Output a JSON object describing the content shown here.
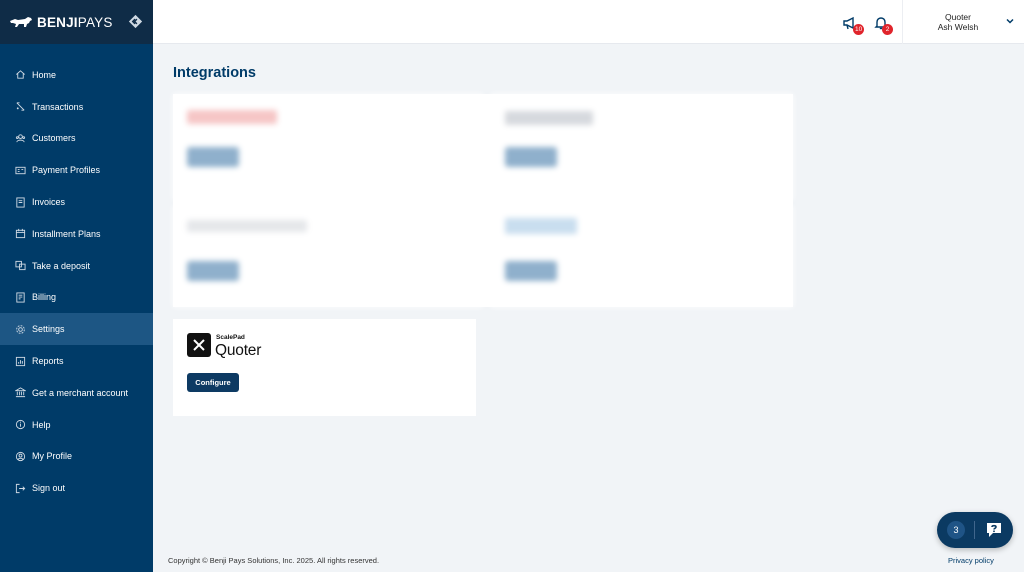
{
  "brand": {
    "name_bold": "BENJI",
    "name_rest": "PAYS"
  },
  "sidebar": {
    "items": [
      {
        "label": "Home",
        "icon": "home-icon"
      },
      {
        "label": "Transactions",
        "icon": "transactions-icon"
      },
      {
        "label": "Customers",
        "icon": "customers-icon"
      },
      {
        "label": "Payment Profiles",
        "icon": "payment-profiles-icon"
      },
      {
        "label": "Invoices",
        "icon": "invoices-icon"
      },
      {
        "label": "Installment Plans",
        "icon": "calendar-icon"
      },
      {
        "label": "Take a deposit",
        "icon": "deposit-icon"
      },
      {
        "label": "Billing",
        "icon": "billing-icon"
      },
      {
        "label": "Settings",
        "icon": "gear-icon",
        "active": true
      },
      {
        "label": "Reports",
        "icon": "reports-icon"
      },
      {
        "label": "Get a merchant account",
        "icon": "bank-icon"
      },
      {
        "label": "Help",
        "icon": "info-icon"
      },
      {
        "label": "My Profile",
        "icon": "user-icon"
      },
      {
        "label": "Sign out",
        "icon": "sign-out-icon"
      }
    ]
  },
  "header": {
    "announcements_count": "10",
    "notifications_count": "2",
    "company": "Quoter",
    "user_name": "Ash Welsh"
  },
  "main": {
    "title": "Integrations",
    "quoter_card": {
      "brand_small": "ScalePad",
      "brand_big": "Quoter",
      "configure_label": "Configure"
    }
  },
  "footer": {
    "copyright": "Copyright © Benji Pays Solutions, Inc. 2025. All rights reserved.",
    "privacy": "Privacy policy"
  },
  "help_widget": {
    "count": "3"
  },
  "colors": {
    "sidebar": "#003b68",
    "brand_bar": "#0f2c47",
    "active": "#1d5684",
    "accent": "#003b68",
    "badge": "#e0242b"
  }
}
